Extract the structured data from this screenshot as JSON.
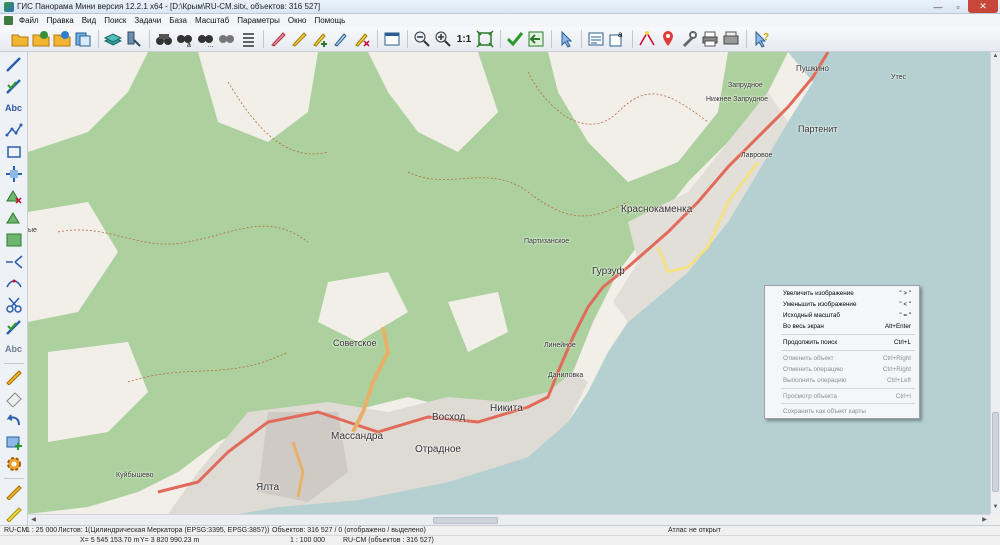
{
  "window": {
    "title": "ГИС Панорама Мини версия 12.2.1 x64 - [D:\\Крым\\RU-CM.sitx, объектов: 316 527]",
    "controls": {
      "minimize": "—",
      "maximize": "▫",
      "close": "✕"
    }
  },
  "menubar": {
    "items": [
      {
        "label": "Файл"
      },
      {
        "label": "Правка"
      },
      {
        "label": "Вид"
      },
      {
        "label": "Поиск"
      },
      {
        "label": "Задачи"
      },
      {
        "label": "База"
      },
      {
        "label": "Масштаб"
      },
      {
        "label": "Параметры"
      },
      {
        "label": "Окно"
      },
      {
        "label": "Помощь"
      }
    ]
  },
  "toolbar": {
    "scale_one_to_one": "1:1",
    "buttons": [
      "open-folder-icon",
      "open-map-icon",
      "add-map-icon",
      "layers-icon",
      "database-icon",
      "find-icon",
      "find-text-icon",
      "find-more-icon",
      "find-next-icon",
      "list-icon",
      "marker-icon",
      "pencil-icon",
      "add-point-icon",
      "edit-point-icon",
      "delete-point-icon",
      "window-icon",
      "zoom-out-icon",
      "zoom-in-icon",
      "fit-icon",
      "check-icon",
      "back-icon",
      "select-icon",
      "properties-icon",
      "object-info-icon",
      "route-icon",
      "pin-icon",
      "tool-icon",
      "print-icon",
      "help-icon"
    ]
  },
  "map": {
    "labels": [
      {
        "text": "Пушкино",
        "size": 8
      },
      {
        "text": "Утес",
        "size": 7
      },
      {
        "text": "Запрудное",
        "size": 7
      },
      {
        "text": "Нижнее Запрудное",
        "size": 7
      },
      {
        "text": "Партенит",
        "size": 9
      },
      {
        "text": "Лавровое",
        "size": 7
      },
      {
        "text": "Краснокаменка",
        "size": 10
      },
      {
        "text": "Партизанское",
        "size": 7
      },
      {
        "text": "Гурзуф",
        "size": 10
      },
      {
        "text": "Советское",
        "size": 9
      },
      {
        "text": "Линейное",
        "size": 7
      },
      {
        "text": "Даниловка",
        "size": 7
      },
      {
        "text": "Никита",
        "size": 10
      },
      {
        "text": "Восход",
        "size": 10
      },
      {
        "text": "Массандра",
        "size": 10
      },
      {
        "text": "Отрадное",
        "size": 10
      },
      {
        "text": "Куйбышево",
        "size": 7
      },
      {
        "text": "Ялта",
        "size": 10
      },
      {
        "text": "ые",
        "size": 7
      }
    ],
    "colors": {
      "sea": "#b5d0d0",
      "forest": "#add19e",
      "land": "#f2efe9",
      "urban": "#dddddd",
      "main_road": "#e26a5a",
      "secondary_road": "#f7e27a",
      "track": "#b56b3a"
    }
  },
  "context_menu": {
    "items": [
      {
        "label": "Увеличить изображение",
        "shortcut": "\" > \"",
        "enabled": true
      },
      {
        "label": "Уменьшить изображение",
        "shortcut": "\" < \"",
        "enabled": true
      },
      {
        "label": "Исходный масштаб",
        "shortcut": "\" = \"",
        "enabled": true
      },
      {
        "label": "Во весь экран",
        "shortcut": "Alt+Enter",
        "enabled": true
      },
      {
        "label": "Продолжить поиск",
        "shortcut": "Ctrl+L",
        "enabled": true
      },
      {
        "label": "Отменить объект",
        "shortcut": "Ctrl+Right",
        "enabled": false
      },
      {
        "label": "Отменить операцию",
        "shortcut": "Ctrl+Right",
        "enabled": false
      },
      {
        "label": "Выполнить операцию",
        "shortcut": "Ctrl+Left",
        "enabled": false
      },
      {
        "label": "Просмотр объекта",
        "shortcut": "Ctrl+I",
        "enabled": false
      },
      {
        "label": "Сохранить как объект карты",
        "shortcut": "",
        "enabled": false
      }
    ]
  },
  "status": {
    "map_name": "RU-CM",
    "scale": "1 : 25 000",
    "sheets": "Листов: 1",
    "projection": "(Цилиндрическая Меркатора (EPSG:3395, EPSG:3857))",
    "objects": "Объектов: 316 527 / 0 (отображено / выделено)",
    "atlas": "Атлас не открыт",
    "x_coord": "X= 5 545 153.70 m",
    "y_coord": "Y= 3 820 990.23 m",
    "view_scale": "1 : 100 000",
    "map_objects": "RU-CM  (объектов : 316 527)"
  }
}
